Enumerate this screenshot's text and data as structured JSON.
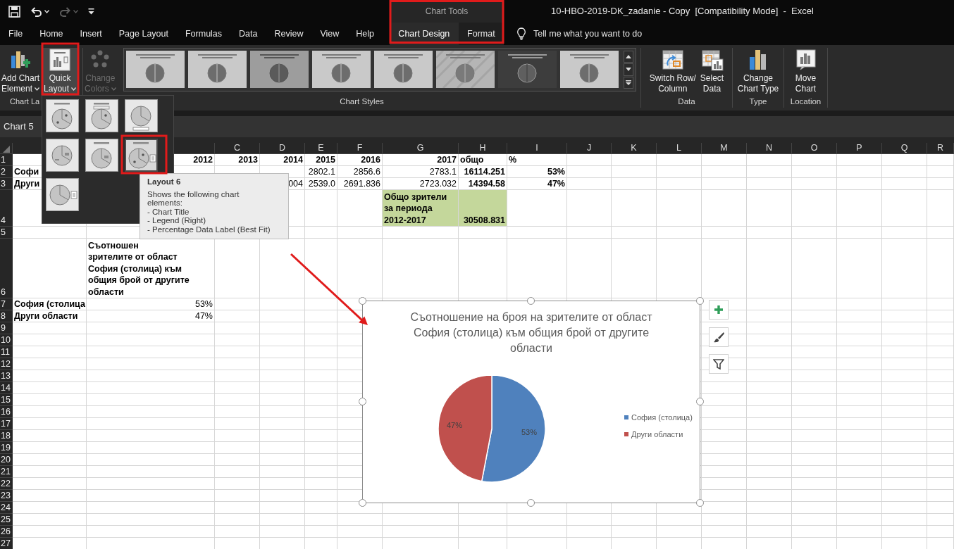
{
  "window": {
    "title": "10-HBO-2019-DK_zadanie - Copy  [Compatibility Mode]  -  Excel"
  },
  "quick_access": [
    {
      "kind": "save",
      "disabled": false
    },
    {
      "kind": "undo",
      "disabled": false
    },
    {
      "kind": "redo",
      "disabled": true
    },
    {
      "kind": "customize",
      "disabled": false
    }
  ],
  "contextual_group": {
    "label": "Chart Tools"
  },
  "tabs": [
    {
      "label": "File",
      "selected": false,
      "contextual": false
    },
    {
      "label": "Home",
      "selected": false,
      "contextual": false
    },
    {
      "label": "Insert",
      "selected": false,
      "contextual": false
    },
    {
      "label": "Page Layout",
      "selected": false,
      "contextual": false
    },
    {
      "label": "Formulas",
      "selected": false,
      "contextual": false
    },
    {
      "label": "Data",
      "selected": false,
      "contextual": false
    },
    {
      "label": "Review",
      "selected": false,
      "contextual": false
    },
    {
      "label": "View",
      "selected": false,
      "contextual": false
    },
    {
      "label": "Help",
      "selected": false,
      "contextual": false
    },
    {
      "label": "Chart Design",
      "selected": true,
      "contextual": true
    },
    {
      "label": "Format",
      "selected": false,
      "contextual": true
    }
  ],
  "tell_me": {
    "placeholder": "Tell me what you want to do"
  },
  "ribbon": {
    "groups": [
      {
        "label": "Chart La",
        "buttons": [
          {
            "kind": "add-element",
            "lines": [
              "Add Chart",
              "Element"
            ],
            "dropdown": true,
            "pressed": false,
            "disabled": false
          },
          {
            "kind": "quick-layout",
            "lines": [
              "Quick",
              "Layout"
            ],
            "dropdown": true,
            "pressed": true,
            "disabled": false
          }
        ]
      },
      {
        "label": "Chart Styles",
        "buttons": [
          {
            "kind": "change-colors",
            "lines": [
              "Change",
              "Colors"
            ],
            "dropdown": true,
            "pressed": false,
            "disabled": true
          }
        ],
        "gallery": [
          {
            "kind": "light"
          },
          {
            "kind": "light"
          },
          {
            "kind": "medium"
          },
          {
            "kind": "light"
          },
          {
            "kind": "light"
          },
          {
            "kind": "striped"
          },
          {
            "kind": "dark"
          },
          {
            "kind": "light"
          }
        ]
      },
      {
        "label": "Data",
        "buttons": [
          {
            "kind": "switch-row",
            "lines": [
              "Switch Row/",
              "Column"
            ],
            "dropdown": false,
            "pressed": false,
            "disabled": false
          },
          {
            "kind": "select-data",
            "lines": [
              "Select",
              "Data"
            ],
            "dropdown": false,
            "pressed": false,
            "disabled": false
          }
        ]
      },
      {
        "label": "Type",
        "buttons": [
          {
            "kind": "change-type",
            "lines": [
              "Change",
              "Chart Type"
            ],
            "dropdown": false,
            "pressed": false,
            "disabled": false
          }
        ]
      },
      {
        "label": "Location",
        "buttons": [
          {
            "kind": "move-chart",
            "lines": [
              "Move",
              "Chart"
            ],
            "dropdown": false,
            "pressed": false,
            "disabled": false
          }
        ]
      }
    ]
  },
  "name_box": {
    "value": "Chart 5"
  },
  "sheet": {
    "column_headers": [
      "C",
      "D",
      "E",
      "F",
      "G",
      "H",
      "I",
      "J",
      "K",
      "L",
      "M",
      "N",
      "O",
      "P",
      "Q",
      "R"
    ],
    "rows": [
      {
        "number": "1",
        "cells": [
          null,
          {
            "text": "2012",
            "bold": true,
            "kind": "number"
          },
          {
            "text": "2013",
            "bold": true,
            "kind": "number"
          },
          {
            "text": "2014",
            "bold": true,
            "kind": "number"
          },
          {
            "text": "2015",
            "bold": true,
            "kind": "number"
          },
          {
            "text": "2016",
            "bold": true,
            "kind": "number"
          },
          {
            "text": "2017",
            "bold": true,
            "kind": "number"
          },
          {
            "text": "общо",
            "bold": true,
            "kind": "text"
          },
          {
            "text": "%",
            "bold": true,
            "kind": "text"
          }
        ]
      },
      {
        "number": "2",
        "cells": [
          {
            "text": "Софи",
            "bold": true,
            "kind": "text"
          },
          null,
          null,
          null,
          {
            "text": "2802.1",
            "bold": false,
            "kind": "number"
          },
          {
            "text": "2856.6",
            "bold": false,
            "kind": "number"
          },
          {
            "text": "2783.1",
            "bold": false,
            "kind": "number"
          },
          {
            "text": "16114.251",
            "bold": true,
            "kind": "number"
          },
          {
            "text": "53%",
            "bold": true,
            "kind": "number"
          }
        ]
      },
      {
        "number": "3",
        "cells": [
          {
            "text": "Други",
            "bold": true,
            "kind": "text"
          },
          null,
          null,
          {
            "text": "004",
            "bold": false,
            "kind": "number"
          },
          {
            "text": "2539.0",
            "bold": false,
            "kind": "number"
          },
          {
            "text": "2691.836",
            "bold": false,
            "kind": "number"
          },
          {
            "text": "2723.032",
            "bold": false,
            "kind": "number"
          },
          {
            "text": "14394.58",
            "bold": true,
            "kind": "number"
          },
          {
            "text": "47%",
            "bold": true,
            "kind": "number"
          }
        ]
      },
      {
        "number": "4",
        "cells": [
          null,
          null,
          null,
          null,
          null,
          null,
          {
            "lines": [
              "Общо зрители",
              "за периода",
              "2012-2017"
            ],
            "bold": true,
            "kind": "text",
            "highlighted": true
          },
          {
            "text": "30508.831",
            "bold": true,
            "kind": "number",
            "highlighted": true
          }
        ]
      },
      {
        "number": "5"
      },
      {
        "number": "6",
        "cells": [
          null,
          {
            "lines": [
              "Съотношен",
              "зрителите от област",
              "София (столица) към",
              "общия брой от другите",
              "области"
            ],
            "bold": true,
            "kind": "text"
          }
        ]
      },
      {
        "number": "7",
        "cells": [
          {
            "text": "София (столица",
            "bold": true,
            "kind": "text"
          },
          {
            "text": "53%",
            "bold": false,
            "kind": "number"
          }
        ]
      },
      {
        "number": "8",
        "cells": [
          {
            "text": "Други области",
            "bold": true,
            "kind": "text"
          },
          {
            "text": "47%",
            "bold": false,
            "kind": "number"
          }
        ]
      },
      {
        "number": "9"
      },
      {
        "number": "10"
      },
      {
        "number": "11"
      },
      {
        "number": "12"
      },
      {
        "number": "13"
      },
      {
        "number": "14"
      },
      {
        "number": "15"
      },
      {
        "number": "16"
      },
      {
        "number": "17"
      },
      {
        "number": "18"
      },
      {
        "number": "19"
      },
      {
        "number": "20"
      },
      {
        "number": "21"
      },
      {
        "number": "22"
      },
      {
        "number": "23"
      },
      {
        "number": "24"
      },
      {
        "number": "25"
      },
      {
        "number": "26"
      },
      {
        "number": "27"
      }
    ],
    "chart": {
      "chart_data": {
        "type": "pie",
        "title": "Съотношение на броя на зрителите от област София (столица) към общия брой от другите области",
        "categories": [
          "София (столица)",
          "Други области"
        ],
        "values": [
          53,
          47
        ],
        "colors": [
          "#4f81bd",
          "#c0504d"
        ],
        "value_labels": [
          "53%",
          "47%"
        ],
        "legend": "right"
      },
      "tools": [
        {
          "kind": "add"
        },
        {
          "kind": "style"
        },
        {
          "kind": "filter"
        }
      ]
    }
  },
  "quick_layout_menu": {
    "layouts": [
      {
        "kind": "layout-1",
        "selected": false
      },
      {
        "kind": "layout-2",
        "selected": false
      },
      {
        "kind": "layout-3",
        "selected": false
      },
      {
        "kind": "layout-4",
        "selected": false
      },
      {
        "kind": "layout-5",
        "selected": false
      },
      {
        "kind": "layout-6",
        "selected": true
      },
      {
        "kind": "layout-7",
        "selected": false
      }
    ]
  },
  "tooltip": {
    "title": "Layout 6",
    "lines": [
      "Shows the following chart",
      "elements:",
      "- Chart Title",
      "- Legend (Right)",
      "- Percentage Data Label (Best Fit)"
    ]
  }
}
